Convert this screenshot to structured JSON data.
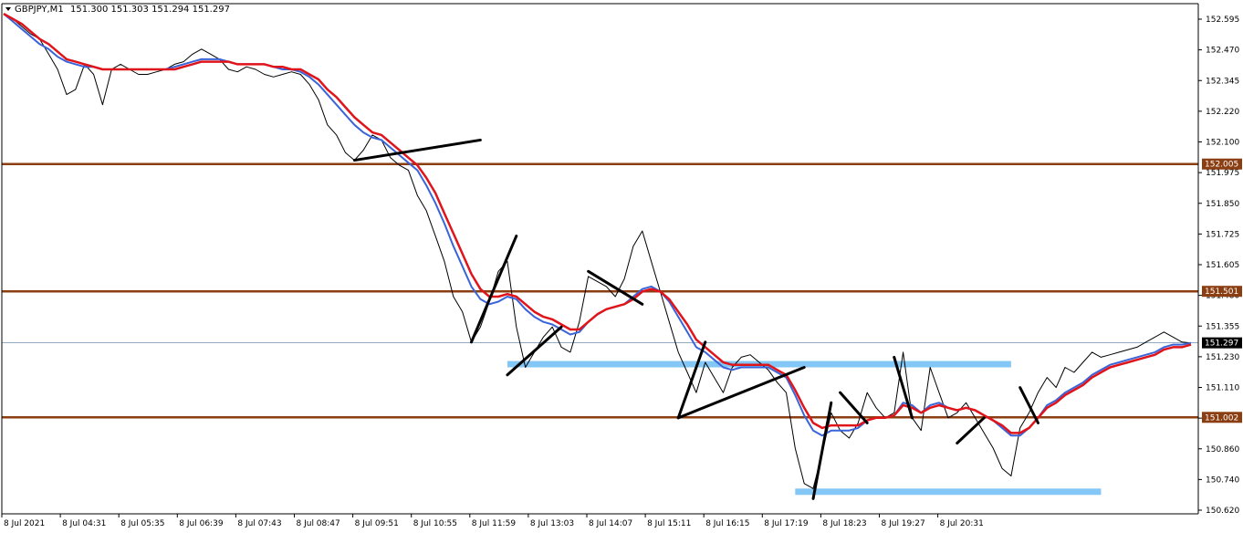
{
  "header": {
    "symbol": "GBPJPY,M1",
    "ohlc": "151.300 151.303 151.294 151.297"
  },
  "colors": {
    "background": "#ffffff",
    "price": "#000000",
    "level_line": "#8b3e12",
    "current_line": "#6e8fb0",
    "ema_fast": "#3a64d8",
    "ema_slow": "#e0141b",
    "zone": "#82c7f5"
  },
  "chart_data": {
    "type": "line",
    "ylim": [
      150.62,
      152.64
    ],
    "y_ticks": [
      "152.595",
      "152.470",
      "152.345",
      "152.220",
      "152.100",
      "151.975",
      "151.850",
      "151.725",
      "151.605",
      "151.480",
      "151.355",
      "151.230",
      "151.110",
      "150.985",
      "150.860",
      "150.740",
      "150.620"
    ],
    "x_ticks": [
      "8 Jul 2021",
      "8 Jul 04:31",
      "8 Jul 05:35",
      "8 Jul 06:39",
      "8 Jul 07:43",
      "8 Jul 08:47",
      "8 Jul 09:51",
      "8 Jul 10:55",
      "8 Jul 11:59",
      "8 Jul 13:03",
      "8 Jul 14:07",
      "8 Jul 15:11",
      "8 Jul 16:15",
      "8 Jul 17:19",
      "8 Jul 18:23",
      "8 Jul 19:27",
      "8 Jul 20:31"
    ],
    "levels": [
      {
        "label": "152.005",
        "value": 152.005
      },
      {
        "label": "151.501",
        "value": 151.501
      },
      {
        "label": "151.002",
        "value": 151.002
      }
    ],
    "current_price": {
      "label": "151.297",
      "value": 151.297
    },
    "series": [
      {
        "values": [
          152.6,
          152.58,
          152.55,
          152.52,
          152.5,
          152.44,
          152.38,
          152.28,
          152.3,
          152.4,
          152.36,
          152.24,
          152.38,
          152.4,
          152.38,
          152.36,
          152.36,
          152.37,
          152.38,
          152.4,
          152.41,
          152.44,
          152.46,
          152.44,
          152.42,
          152.38,
          152.37,
          152.39,
          152.38,
          152.36,
          152.35,
          152.36,
          152.37,
          152.36,
          152.32,
          152.26,
          152.16,
          152.12,
          152.05,
          152.02,
          152.06,
          152.12,
          152.1,
          152.03,
          152.0,
          151.98,
          151.88,
          151.82,
          151.72,
          151.62,
          151.48,
          151.42,
          151.3,
          151.36,
          151.46,
          151.58,
          151.62,
          151.36,
          151.2,
          151.26,
          151.32,
          151.36,
          151.28,
          151.26,
          151.38,
          151.56,
          151.54,
          151.52,
          151.48,
          151.55,
          151.68,
          151.74,
          151.62,
          151.5,
          151.38,
          151.26,
          151.18,
          151.1,
          151.22,
          151.16,
          151.1,
          151.2,
          151.24,
          151.25,
          151.22,
          151.19,
          151.14,
          151.1,
          150.88,
          150.74,
          150.72,
          150.86,
          151.02,
          150.95,
          150.92,
          150.98,
          151.1,
          151.04,
          151.0,
          151.02,
          151.26,
          151.0,
          150.95,
          151.2,
          151.1,
          151.0,
          151.02,
          151.06,
          151.0,
          150.94,
          150.88,
          150.8,
          150.77,
          150.96,
          151.02,
          151.1,
          151.16,
          151.12,
          151.2,
          151.18,
          151.22,
          151.26,
          151.24,
          151.25,
          151.26,
          151.27,
          151.28,
          151.3,
          151.32,
          151.34,
          151.32,
          151.3,
          151.297
        ]
      },
      {
        "name": "",
        "values": [
          152.6,
          152.57,
          152.54,
          152.51,
          152.48,
          152.46,
          152.43,
          152.41,
          152.4,
          152.39,
          152.39,
          152.38,
          152.38,
          152.38,
          152.38,
          152.38,
          152.38,
          152.38,
          152.38,
          152.39,
          152.4,
          152.41,
          152.42,
          152.42,
          152.42,
          152.41,
          152.4,
          152.4,
          152.4,
          152.4,
          152.39,
          152.38,
          152.38,
          152.37,
          152.35,
          152.32,
          152.28,
          152.24,
          152.2,
          152.16,
          152.13,
          152.11,
          152.1,
          152.07,
          152.04,
          152.01,
          151.98,
          151.92,
          151.85,
          151.77,
          151.68,
          151.6,
          151.52,
          151.47,
          151.45,
          151.46,
          151.48,
          151.47,
          151.43,
          151.4,
          151.38,
          151.37,
          151.35,
          151.33,
          151.34,
          151.38,
          151.41,
          151.43,
          151.44,
          151.45,
          151.48,
          151.51,
          151.52,
          151.5,
          151.46,
          151.4,
          151.34,
          151.28,
          151.26,
          151.23,
          151.2,
          151.19,
          151.2,
          151.2,
          151.2,
          151.2,
          151.18,
          151.16,
          151.09,
          151.01,
          150.95,
          150.93,
          150.95,
          150.95,
          150.95,
          150.96,
          150.99,
          151.0,
          151.0,
          151.01,
          151.06,
          151.05,
          151.02,
          151.05,
          151.06,
          151.04,
          151.03,
          151.04,
          151.03,
          151.01,
          150.99,
          150.96,
          150.93,
          150.93,
          150.96,
          151.0,
          151.05,
          151.07,
          151.1,
          151.12,
          151.14,
          151.17,
          151.19,
          151.21,
          151.22,
          151.23,
          151.24,
          151.25,
          151.26,
          151.28,
          151.29,
          151.29,
          151.297
        ]
      },
      {
        "name": "",
        "values": [
          152.6,
          152.58,
          152.56,
          152.53,
          152.5,
          152.48,
          152.45,
          152.42,
          152.41,
          152.4,
          152.39,
          152.38,
          152.38,
          152.38,
          152.38,
          152.38,
          152.38,
          152.38,
          152.38,
          152.38,
          152.39,
          152.4,
          152.41,
          152.41,
          152.41,
          152.41,
          152.4,
          152.4,
          152.4,
          152.4,
          152.39,
          152.39,
          152.38,
          152.38,
          152.36,
          152.34,
          152.3,
          152.27,
          152.23,
          152.19,
          152.16,
          152.13,
          152.12,
          152.09,
          152.06,
          152.03,
          152.0,
          151.95,
          151.89,
          151.81,
          151.73,
          151.65,
          151.57,
          151.51,
          151.48,
          151.48,
          151.49,
          151.48,
          151.45,
          151.42,
          151.4,
          151.39,
          151.37,
          151.35,
          151.35,
          151.38,
          151.41,
          151.43,
          151.44,
          151.45,
          151.47,
          151.5,
          151.51,
          151.5,
          151.47,
          151.42,
          151.37,
          151.31,
          151.28,
          151.25,
          151.22,
          151.21,
          151.21,
          151.21,
          151.21,
          151.21,
          151.19,
          151.17,
          151.11,
          151.04,
          150.98,
          150.96,
          150.97,
          150.97,
          150.97,
          150.97,
          150.99,
          151.0,
          151.0,
          151.01,
          151.05,
          151.04,
          151.02,
          151.04,
          151.05,
          151.04,
          151.03,
          151.04,
          151.03,
          151.01,
          150.99,
          150.97,
          150.94,
          150.94,
          150.96,
          151.0,
          151.04,
          151.06,
          151.09,
          151.11,
          151.13,
          151.16,
          151.18,
          151.2,
          151.21,
          151.22,
          151.23,
          151.24,
          151.25,
          151.27,
          151.28,
          151.28,
          151.29
        ]
      }
    ],
    "zones": [
      {
        "from": 151.2,
        "to": 151.225,
        "x_from": 56,
        "x_to": 112
      },
      {
        "from": 150.695,
        "to": 150.72,
        "x_from": 88,
        "x_to": 122
      }
    ],
    "trendlines": [
      [
        [
          39,
          152.02
        ],
        [
          53,
          152.1
        ]
      ],
      [
        [
          52,
          151.3
        ],
        [
          57,
          151.72
        ]
      ],
      [
        [
          56,
          151.17
        ],
        [
          62,
          151.36
        ]
      ],
      [
        [
          65,
          151.58
        ],
        [
          71,
          151.45
        ]
      ],
      [
        [
          75,
          151.0
        ],
        [
          89,
          151.2
        ]
      ],
      [
        [
          75,
          151.0
        ],
        [
          78,
          151.3
        ]
      ],
      [
        [
          90,
          150.68
        ],
        [
          92,
          151.06
        ]
      ],
      [
        [
          93,
          151.1
        ],
        [
          96,
          150.98
        ]
      ],
      [
        [
          99,
          151.24
        ],
        [
          101,
          151.0
        ]
      ],
      [
        [
          106,
          150.9
        ],
        [
          109,
          151.0
        ]
      ],
      [
        [
          113,
          151.12
        ],
        [
          115,
          150.98
        ]
      ]
    ]
  }
}
